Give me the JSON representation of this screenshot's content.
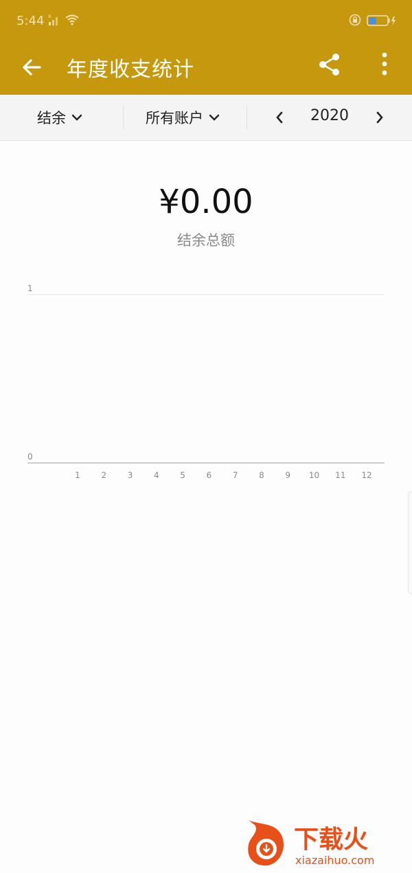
{
  "status_bar": {
    "time": "5:44"
  },
  "app_bar": {
    "title": "年度收支统计"
  },
  "filters": {
    "type": "结余",
    "account": "所有账户",
    "year": "2020"
  },
  "summary": {
    "amount": "¥0.00",
    "label": "结余总额"
  },
  "chart_data": {
    "type": "line",
    "categories": [
      "1",
      "2",
      "3",
      "4",
      "5",
      "6",
      "7",
      "8",
      "9",
      "10",
      "11",
      "12"
    ],
    "values": [],
    "ylim": [
      0,
      1
    ],
    "y_ticks": [
      "0",
      "1"
    ],
    "grid": true
  },
  "watermark": {
    "brand": "下载火",
    "url": "xiazaihuo.com"
  },
  "colors": {
    "primary": "#c6980e",
    "watermark": "#e8501a"
  }
}
